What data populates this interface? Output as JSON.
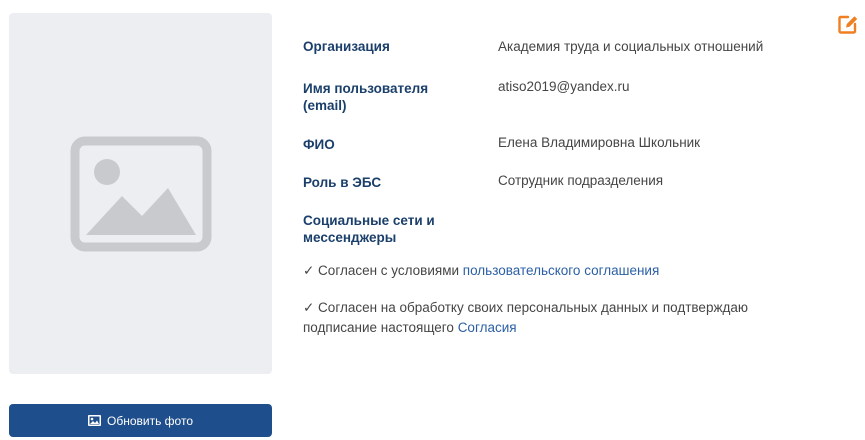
{
  "colors": {
    "accent_button": "#1f4e8c",
    "label_text": "#1b3f6b",
    "link": "#2b5fa5",
    "edit_icon": "#f07f22",
    "photo_background": "#eceef1",
    "placeholder_icon": "#c8cacd"
  },
  "icons": {
    "photo_placeholder": "image-placeholder-icon",
    "update_button": "image-icon",
    "edit": "edit-icon"
  },
  "photo": {
    "update_button_label": "Обновить фото"
  },
  "profile": {
    "fields": [
      {
        "label": "Организация",
        "value": "Академия труда и социальных отношений"
      },
      {
        "label": "Имя пользователя (email)",
        "value": "atiso2019@yandex.ru"
      },
      {
        "label": "ФИО",
        "value": "Елена Владимировна Школьник"
      },
      {
        "label": "Роль в ЭБС",
        "value": "Сотрудник подразделения"
      },
      {
        "label": "Социальные сети и мессенджеры",
        "value": ""
      }
    ]
  },
  "consents": [
    {
      "text": "✓ Согласен с условиями ",
      "link": "пользовательского соглашения"
    },
    {
      "text": "✓ Согласен на обработку своих персональных данных и подтверждаю подписание настоящего ",
      "link": "Согласия"
    }
  ]
}
